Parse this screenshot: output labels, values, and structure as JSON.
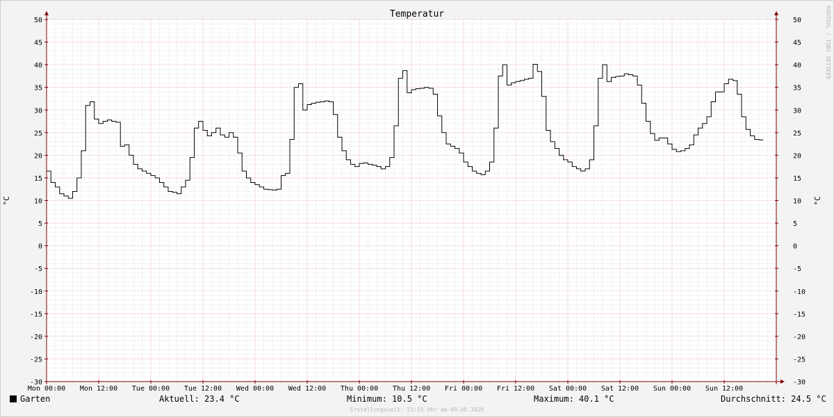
{
  "chart_data": {
    "type": "line",
    "title": "Temperatur",
    "ylabel": "°C",
    "ylabel_right": "°C",
    "ylim": [
      -30,
      50
    ],
    "yticks": [
      50,
      45,
      40,
      35,
      30,
      25,
      20,
      15,
      10,
      5,
      0,
      -5,
      -10,
      -15,
      -20,
      -25,
      -30
    ],
    "xticks": [
      "Mon 00:00",
      "Mon 12:00",
      "Tue 00:00",
      "Tue 12:00",
      "Wed 00:00",
      "Wed 12:00",
      "Thu 00:00",
      "Thu 12:00",
      "Fri 00:00",
      "Fri 12:00",
      "Sat 00:00",
      "Sat 12:00",
      "Sun 00:00",
      "Sun 12:00"
    ],
    "x_unit": "hours since Mon 00:00",
    "grid": true,
    "line_color": "#000000",
    "series": [
      {
        "name": "Garten",
        "points": [
          [
            0,
            16.5
          ],
          [
            1,
            14
          ],
          [
            2,
            13
          ],
          [
            3,
            11.5
          ],
          [
            4,
            11
          ],
          [
            5,
            10.5
          ],
          [
            6,
            12
          ],
          [
            7,
            15
          ],
          [
            8,
            21
          ],
          [
            9,
            31
          ],
          [
            10,
            31.8
          ],
          [
            11,
            28
          ],
          [
            12,
            27
          ],
          [
            13,
            27.5
          ],
          [
            14,
            27.8
          ],
          [
            15,
            27.5
          ],
          [
            16,
            27.3
          ],
          [
            17,
            22
          ],
          [
            18,
            22.3
          ],
          [
            19,
            20
          ],
          [
            20,
            18
          ],
          [
            21,
            17
          ],
          [
            22,
            16.5
          ],
          [
            23,
            16
          ],
          [
            24,
            15.5
          ],
          [
            25,
            15
          ],
          [
            26,
            14
          ],
          [
            27,
            13
          ],
          [
            28,
            12
          ],
          [
            29,
            11.8
          ],
          [
            30,
            11.5
          ],
          [
            31,
            13
          ],
          [
            32,
            14.5
          ],
          [
            33,
            19.5
          ],
          [
            34,
            26
          ],
          [
            35,
            27.5
          ],
          [
            36,
            25.5
          ],
          [
            37,
            24.3
          ],
          [
            38,
            25
          ],
          [
            39,
            26
          ],
          [
            40,
            24.5
          ],
          [
            41,
            24
          ],
          [
            42,
            25
          ],
          [
            43,
            24
          ],
          [
            44,
            20.5
          ],
          [
            45,
            16.5
          ],
          [
            46,
            15
          ],
          [
            47,
            14
          ],
          [
            48,
            13.5
          ],
          [
            49,
            13
          ],
          [
            50,
            12.5
          ],
          [
            51,
            12.4
          ],
          [
            52,
            12.3
          ],
          [
            53,
            12.5
          ],
          [
            54,
            15.5
          ],
          [
            55,
            16
          ],
          [
            56,
            23.5
          ],
          [
            57,
            35
          ],
          [
            58,
            35.8
          ],
          [
            59,
            30
          ],
          [
            60,
            31.2
          ],
          [
            61,
            31.5
          ],
          [
            62,
            31.7
          ],
          [
            63,
            31.8
          ],
          [
            64,
            32
          ],
          [
            65,
            31.8
          ],
          [
            66,
            29
          ],
          [
            67,
            24
          ],
          [
            68,
            21
          ],
          [
            69,
            19
          ],
          [
            70,
            18
          ],
          [
            71,
            17.5
          ],
          [
            72,
            18.2
          ],
          [
            73,
            18.3
          ],
          [
            74,
            18
          ],
          [
            75,
            17.8
          ],
          [
            76,
            17.5
          ],
          [
            77,
            17
          ],
          [
            78,
            17.5
          ],
          [
            79,
            19.5
          ],
          [
            80,
            26.5
          ],
          [
            81,
            37
          ],
          [
            82,
            38.7
          ],
          [
            83,
            33.8
          ],
          [
            84,
            34.5
          ],
          [
            85,
            34.7
          ],
          [
            86,
            34.8
          ],
          [
            87,
            35
          ],
          [
            88,
            34.8
          ],
          [
            89,
            33.5
          ],
          [
            90,
            28.7
          ],
          [
            91,
            25
          ],
          [
            92,
            22.5
          ],
          [
            93,
            22
          ],
          [
            94,
            21.5
          ],
          [
            95,
            20.5
          ],
          [
            96,
            18.5
          ],
          [
            97,
            17.5
          ],
          [
            98,
            16.5
          ],
          [
            99,
            16
          ],
          [
            100,
            15.7
          ],
          [
            101,
            16.5
          ],
          [
            102,
            18.5
          ],
          [
            103,
            26
          ],
          [
            104,
            37.5
          ],
          [
            105,
            40
          ],
          [
            106,
            35.5
          ],
          [
            107,
            36
          ],
          [
            108,
            36.3
          ],
          [
            109,
            36.5
          ],
          [
            110,
            36.8
          ],
          [
            111,
            37
          ],
          [
            112,
            40.1
          ],
          [
            113,
            38.5
          ],
          [
            114,
            33
          ],
          [
            115,
            25.5
          ],
          [
            116,
            23
          ],
          [
            117,
            21.5
          ],
          [
            118,
            20
          ],
          [
            119,
            19
          ],
          [
            120,
            18.5
          ],
          [
            121,
            17.5
          ],
          [
            122,
            17
          ],
          [
            123,
            16.5
          ],
          [
            124,
            17
          ],
          [
            125,
            19
          ],
          [
            126,
            26.5
          ],
          [
            127,
            37
          ],
          [
            128,
            40
          ],
          [
            129,
            36.3
          ],
          [
            130,
            37.2
          ],
          [
            131,
            37.4
          ],
          [
            132,
            37.5
          ],
          [
            133,
            38
          ],
          [
            134,
            37.8
          ],
          [
            135,
            37.5
          ],
          [
            136,
            35.5
          ],
          [
            137,
            31.5
          ],
          [
            138,
            27.5
          ],
          [
            139,
            24.8
          ],
          [
            140,
            23.3
          ],
          [
            141,
            23.8
          ],
          [
            142,
            23.8
          ],
          [
            143,
            22.5
          ],
          [
            144,
            21.3
          ],
          [
            145,
            20.8
          ],
          [
            146,
            21
          ],
          [
            147,
            21.5
          ],
          [
            148,
            22.3
          ],
          [
            149,
            24.5
          ],
          [
            150,
            26
          ],
          [
            151,
            27
          ],
          [
            152,
            28.5
          ],
          [
            153,
            31.8
          ],
          [
            154,
            34
          ],
          [
            155,
            34
          ],
          [
            156,
            35.8
          ],
          [
            157,
            36.8
          ],
          [
            158,
            36.5
          ],
          [
            159,
            33.5
          ],
          [
            160,
            28.5
          ],
          [
            161,
            25.7
          ],
          [
            162,
            24.3
          ],
          [
            163,
            23.5
          ],
          [
            164,
            23.4
          ]
        ]
      }
    ]
  },
  "legend": {
    "series_label": "Garten",
    "series_color": "#000000",
    "current": "Aktuell: 23.4 °C",
    "minimum": "Minimum: 10.5 °C",
    "maximum": "Maximum: 40.1 °C",
    "average": "Durchschnitt: 24.5 °C"
  },
  "footer": "Erstellungszeit: 23:55 Uhr am 09.08.2020",
  "watermark": "RRDTOOL / TOBI OETIKER",
  "colors": {
    "background": "#f3f3f3",
    "plot_background": "#ffffff",
    "major_grid": "#e8a9b2",
    "minor_grid": "#d8d8d8",
    "axis": "#800000",
    "line": "#000000"
  }
}
